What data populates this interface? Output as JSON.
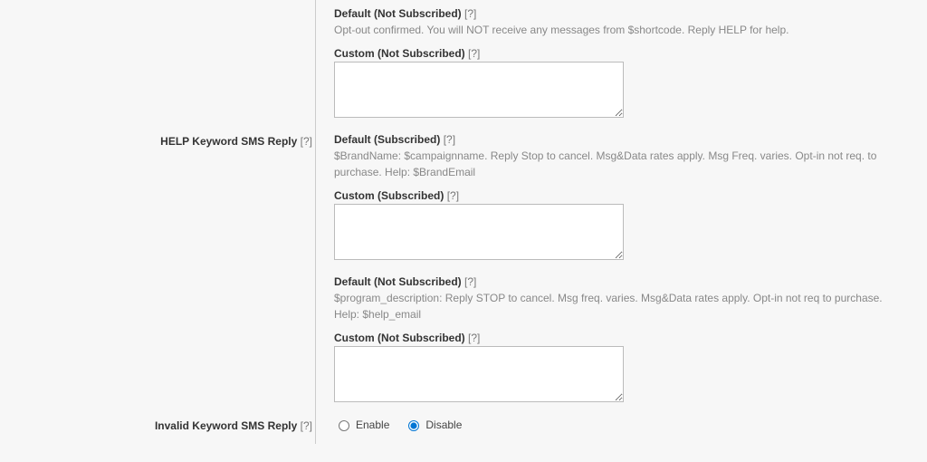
{
  "section1": {
    "default_not_sub_label": "Default (Not Subscribed)",
    "q": "[?]",
    "default_not_sub_text": "Opt-out confirmed. You will NOT receive any messages from $shortcode. Reply HELP for help.",
    "custom_not_sub_label": "Custom (Not Subscribed)"
  },
  "section2": {
    "left_label": "HELP Keyword SMS Reply",
    "q": "[?]",
    "default_sub_label": "Default (Subscribed)",
    "default_sub_text": "$BrandName: $campaignname. Reply Stop to cancel. Msg&Data rates apply. Msg Freq. varies. Opt-in not req. to purchase. Help: $BrandEmail",
    "custom_sub_label": "Custom (Subscribed)",
    "default_not_sub_label": "Default (Not Subscribed)",
    "default_not_sub_text": "$program_description: Reply STOP to cancel. Msg freq. varies. Msg&Data rates apply. Opt-in not req to purchase. Help: $help_email",
    "custom_not_sub_label": "Custom (Not Subscribed)"
  },
  "section3": {
    "left_label": "Invalid Keyword SMS Reply",
    "q": "[?]",
    "enable_label": "Enable",
    "disable_label": "Disable"
  }
}
